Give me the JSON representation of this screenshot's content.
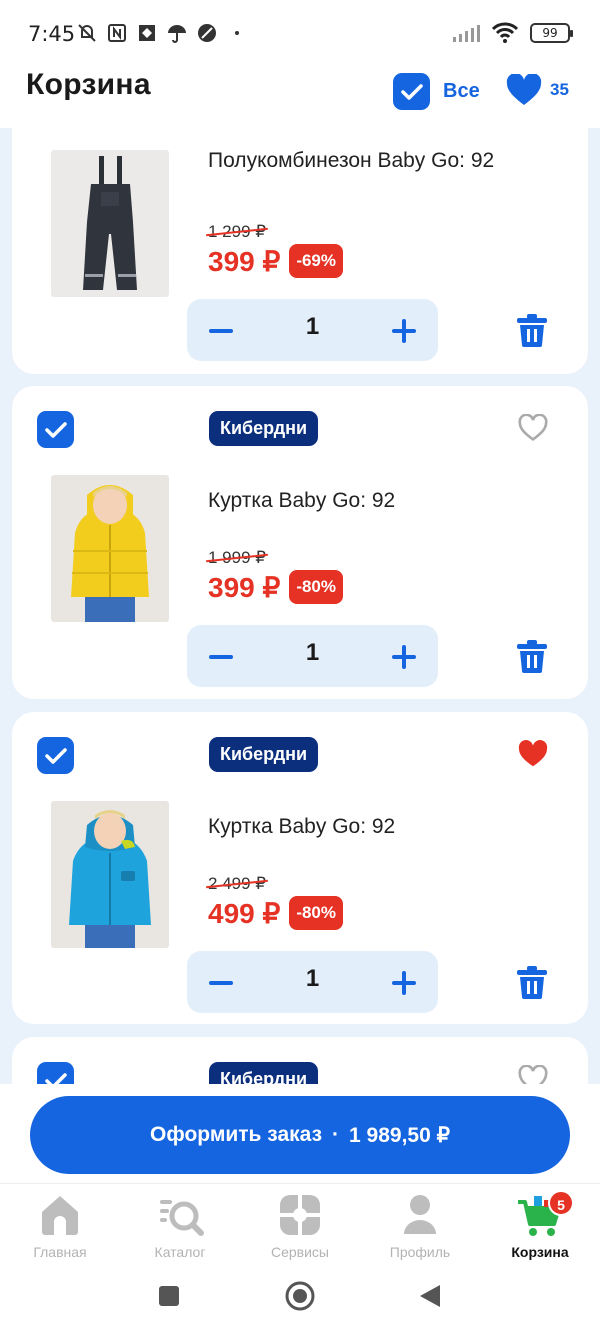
{
  "status": {
    "time": "7:45",
    "battery": "99"
  },
  "header": {
    "title": "Корзина",
    "select_all_label": "Все",
    "favorites_count": "35"
  },
  "items": [
    {
      "brand": "",
      "name": "Полукомбинезон Baby Go: 92",
      "old_price": "1 299 ₽",
      "price": "399 ₽",
      "discount": "-69%",
      "quantity": "1",
      "favorite": false
    },
    {
      "brand": "Кибердни",
      "name": "Куртка Baby Go: 92",
      "old_price": "1 999 ₽",
      "price": "399 ₽",
      "discount": "-80%",
      "quantity": "1",
      "favorite": false
    },
    {
      "brand": "Кибердни",
      "name": "Куртка Baby Go: 92",
      "old_price": "2 499 ₽",
      "price": "499 ₽",
      "discount": "-80%",
      "quantity": "1",
      "favorite": true
    },
    {
      "brand": "Кибердни"
    }
  ],
  "checkout": {
    "label": "Оформить заказ",
    "separator": "·",
    "total": "1 989,50 ₽"
  },
  "tabs": [
    {
      "label": "Главная",
      "icon": "home-icon"
    },
    {
      "label": "Каталог",
      "icon": "catalog-search-icon"
    },
    {
      "label": "Сервисы",
      "icon": "services-icon"
    },
    {
      "label": "Профиль",
      "icon": "profile-icon"
    },
    {
      "label": "Корзина",
      "icon": "cart-icon",
      "badge": "5",
      "active": true
    }
  ],
  "colors": {
    "accent": "#1565e0",
    "sale": "#e53224",
    "brand_badge": "#0b2f7d",
    "list_bg": "#e9f1fb"
  }
}
